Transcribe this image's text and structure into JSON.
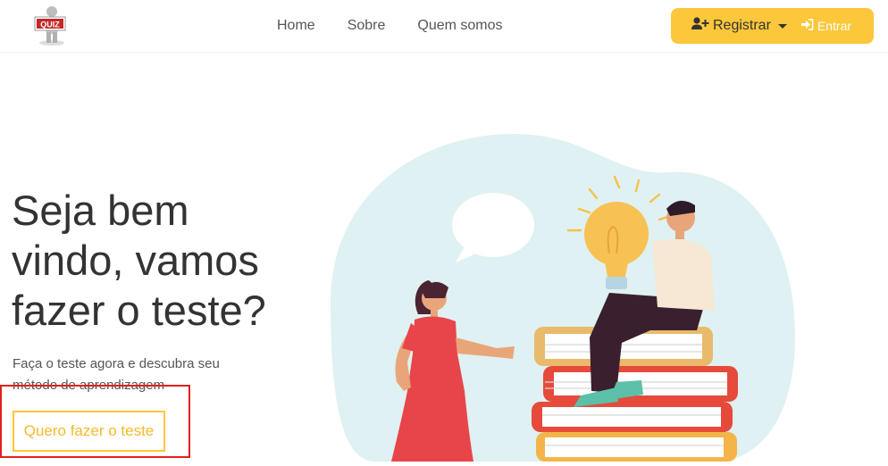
{
  "logo": {
    "text": "QUIZ"
  },
  "nav": {
    "links": [
      "Home",
      "Sobre",
      "Quem somos"
    ],
    "register_label": "Registrar",
    "login_label": "Entrar"
  },
  "hero": {
    "title_line1": "Seja bem",
    "title_line2": "vindo, vamos",
    "title_line3": "fazer o teste?",
    "subtitle": "Faça o teste agora e descubra seu método de aprendizagem",
    "cta_label": "Quero fazer o teste"
  },
  "colors": {
    "accent": "#fcc73a",
    "highlight": "#e0201e",
    "blob": "#dff1f2"
  },
  "icons": [
    "user-plus-icon",
    "caret-down-icon",
    "sign-in-icon",
    "lightbulb-illustration",
    "speech-bubble-icon"
  ]
}
